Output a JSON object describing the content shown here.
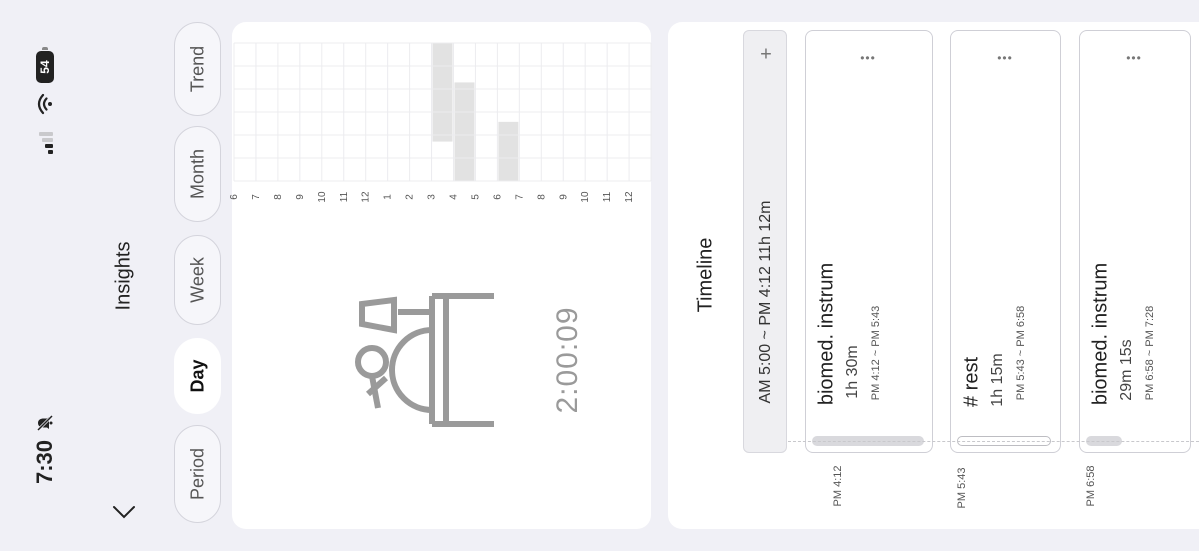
{
  "status": {
    "time": "7:30",
    "battery": "54"
  },
  "header": {
    "title": "Insights"
  },
  "segments": [
    {
      "label": "Trend",
      "active": false
    },
    {
      "label": "Month",
      "active": false
    },
    {
      "label": "Week",
      "active": false
    },
    {
      "label": "Day",
      "active": true
    },
    {
      "label": "Period",
      "active": false
    }
  ],
  "chart_data": {
    "type": "heatmap",
    "tick_labels": [
      "6",
      "7",
      "8",
      "9",
      "10",
      "11",
      "12",
      "1",
      "2",
      "3",
      "4",
      "5",
      "6",
      "7",
      "8",
      "9",
      "10",
      "11",
      "12"
    ],
    "filled": [
      {
        "hour": "4",
        "rows": [
          0,
          1,
          2,
          3,
          4
        ]
      },
      {
        "hour": "5",
        "rows": [
          2,
          3,
          4,
          5,
          6
        ]
      },
      {
        "hour": "7",
        "rows": [
          4,
          5,
          6
        ]
      }
    ],
    "cell_color": "#e2e2e2",
    "grid": true
  },
  "summary": {
    "duration": "2:00:09"
  },
  "timeline": {
    "title": "Timeline",
    "range": "AM 5:00 ~ PM 4:12  11h 12m",
    "add_symbol": "+",
    "entries": [
      {
        "title": "biomed. instrum",
        "duration": "1h 30m",
        "range": "PM 4:12 ~ PM 5:43",
        "marker": "PM 4:12",
        "pill": "filled",
        "progress": 1.0
      },
      {
        "title": "# rest",
        "duration": "1h 15m",
        "range": "PM 5:43 ~ PM 6:58",
        "marker": "PM 5:43",
        "pill": "outline",
        "progress": 1.0
      },
      {
        "title": "biomed. instrum",
        "duration": "29m 15s",
        "range": "PM 6:58 ~ PM 7:28",
        "marker": "PM 6:58",
        "pill": "filled",
        "progress": 0.3
      }
    ]
  },
  "colors": {
    "background": "#f0f0f6",
    "card": "#ffffff",
    "accent_gray": "#9a9a9a"
  },
  "icons": [
    "chevron-down-icon",
    "wifi-icon",
    "signal-icon",
    "silent-bell-icon",
    "mascot-icon",
    "more-icon",
    "plus-icon"
  ]
}
